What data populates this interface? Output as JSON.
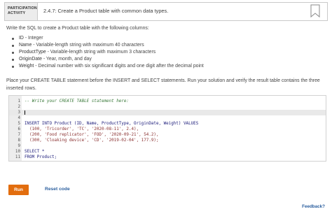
{
  "header": {
    "badge_line1": "PARTICIPATION",
    "badge_line2": "ACTIVITY",
    "title": "2.4.7: Create a Product table with common data types."
  },
  "instructions": {
    "intro": "Write the SQL to create a Product table with the following columns:",
    "columns": [
      {
        "name": "ID",
        "desc": " - Integer"
      },
      {
        "name": "Name",
        "desc": " - Variable-length string with maximum 40 characters"
      },
      {
        "name": "ProductType",
        "desc": " - Variable-length string with maximum 3 characters"
      },
      {
        "name": "OriginDate",
        "desc": " - Year, month, and day"
      },
      {
        "name": "Weight",
        "desc": " - Decimal number with six significant digits and one digit after the decimal point"
      }
    ],
    "place_text": "Place your CREATE TABLE statement before the INSERT and SELECT statements. Run your solution and verify the result table contains the three inserted rows."
  },
  "editor": {
    "lines": [
      {
        "n": "1",
        "text": "-- Write your CREATE TABLE statement here:"
      },
      {
        "n": "2",
        "text": ""
      },
      {
        "n": "3",
        "text": ""
      },
      {
        "n": "4",
        "text": ""
      },
      {
        "n": "5",
        "text": "INSERT INTO Product (ID, Name, ProductType, OriginDate, Weight) VALUES"
      },
      {
        "n": "6",
        "text": "  (100, 'Tricorder', 'TC', '2020-08-11', 2.4),"
      },
      {
        "n": "7",
        "text": "  (200, 'Food replicator', 'FOD', '2020-09-21', 54.2),"
      },
      {
        "n": "8",
        "text": "  (300, 'Cloaking device', 'CD', '2019-02-04', 177.9);"
      },
      {
        "n": "9",
        "text": ""
      },
      {
        "n": "10",
        "text": "SELECT *"
      },
      {
        "n": "11",
        "text": "FROM Product;"
      }
    ]
  },
  "buttons": {
    "run": "Run",
    "reset": "Reset code",
    "feedback": "Feedback?"
  },
  "colors": {
    "run_button": "#e26d0e",
    "link": "#2a5e9e"
  }
}
